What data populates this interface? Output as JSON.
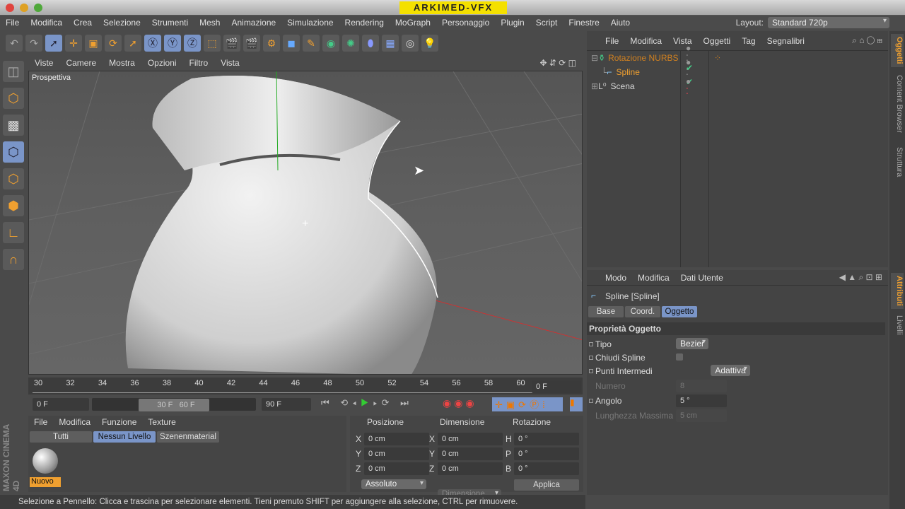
{
  "window": {
    "title": "ARKIMED-VFX"
  },
  "menu": [
    "File",
    "Modifica",
    "Crea",
    "Selezione",
    "Strumenti",
    "Mesh",
    "Animazione",
    "Simulazione",
    "Rendering",
    "MoGraph",
    "Personaggio",
    "Plugin",
    "Script",
    "Finestre",
    "Aiuto"
  ],
  "layout": {
    "label": "Layout:",
    "value": "Standard 720p"
  },
  "viewport": {
    "menu": [
      "Viste",
      "Camere",
      "Mostra",
      "Opzioni",
      "Filtro",
      "Vista"
    ],
    "label": "Prospettiva"
  },
  "timeline": {
    "ticks": [
      "30",
      "32",
      "34",
      "36",
      "38",
      "40",
      "42",
      "44",
      "46",
      "48",
      "50",
      "52",
      "54",
      "56",
      "58",
      "60"
    ],
    "current": "0 F",
    "start": "0 F",
    "range_start": "30 F",
    "range_end": "60 F",
    "end": "90 F"
  },
  "materials": {
    "menu": [
      "File",
      "Modifica",
      "Funzione",
      "Texture"
    ],
    "filters": [
      "Tutti",
      "Nessun Livello",
      "Szenenmaterial"
    ],
    "new_label": "Nuovo"
  },
  "coords": {
    "headers": [
      "Posizione",
      "Dimensione",
      "Rotazione"
    ],
    "rows": [
      {
        "a": "X",
        "av": "0 cm",
        "b": "X",
        "bv": "0 cm",
        "c": "H",
        "cv": "0 °"
      },
      {
        "a": "Y",
        "av": "0 cm",
        "b": "Y",
        "bv": "0 cm",
        "c": "P",
        "cv": "0 °"
      },
      {
        "a": "Z",
        "av": "0 cm",
        "b": "Z",
        "bv": "0 cm",
        "c": "B",
        "cv": "0 °"
      }
    ],
    "mode": "Assoluto",
    "dim_mode": "Dimensione",
    "apply": "Applica"
  },
  "status": "Selezione a Pennello: Clicca e trascina per selezionare elementi. Tieni premuto SHIFT per aggiungere alla selezione, CTRL per rimuovere.",
  "objects": {
    "menu": [
      "File",
      "Modifica",
      "Vista",
      "Oggetti",
      "Tag",
      "Segnalibri"
    ],
    "items": [
      "Rotazione NURBS",
      "Spline",
      "Scena"
    ]
  },
  "attributes": {
    "menu": [
      "Modo",
      "Modifica",
      "Dati Utente"
    ],
    "object": "Spline [Spline]",
    "tabs": [
      "Base",
      "Coord.",
      "Oggetto"
    ],
    "section": "Proprietà Oggetto",
    "fields": {
      "tipo_label": "Tipo",
      "tipo": "Bezier",
      "chiudi_label": "Chiudi Spline",
      "punti_label": "Punti Intermedi",
      "punti": "Adattiva",
      "numero_label": "Numero",
      "numero": "8",
      "angolo_label": "Angolo",
      "angolo": "5 °",
      "lung_label": "Lunghezza Massima",
      "lung": "5 cm"
    }
  },
  "side_tabs": [
    "Oggetti",
    "Content Browser",
    "Struttura",
    "Attributi",
    "Livelli"
  ],
  "brand": "MAXON CINEMA 4D"
}
